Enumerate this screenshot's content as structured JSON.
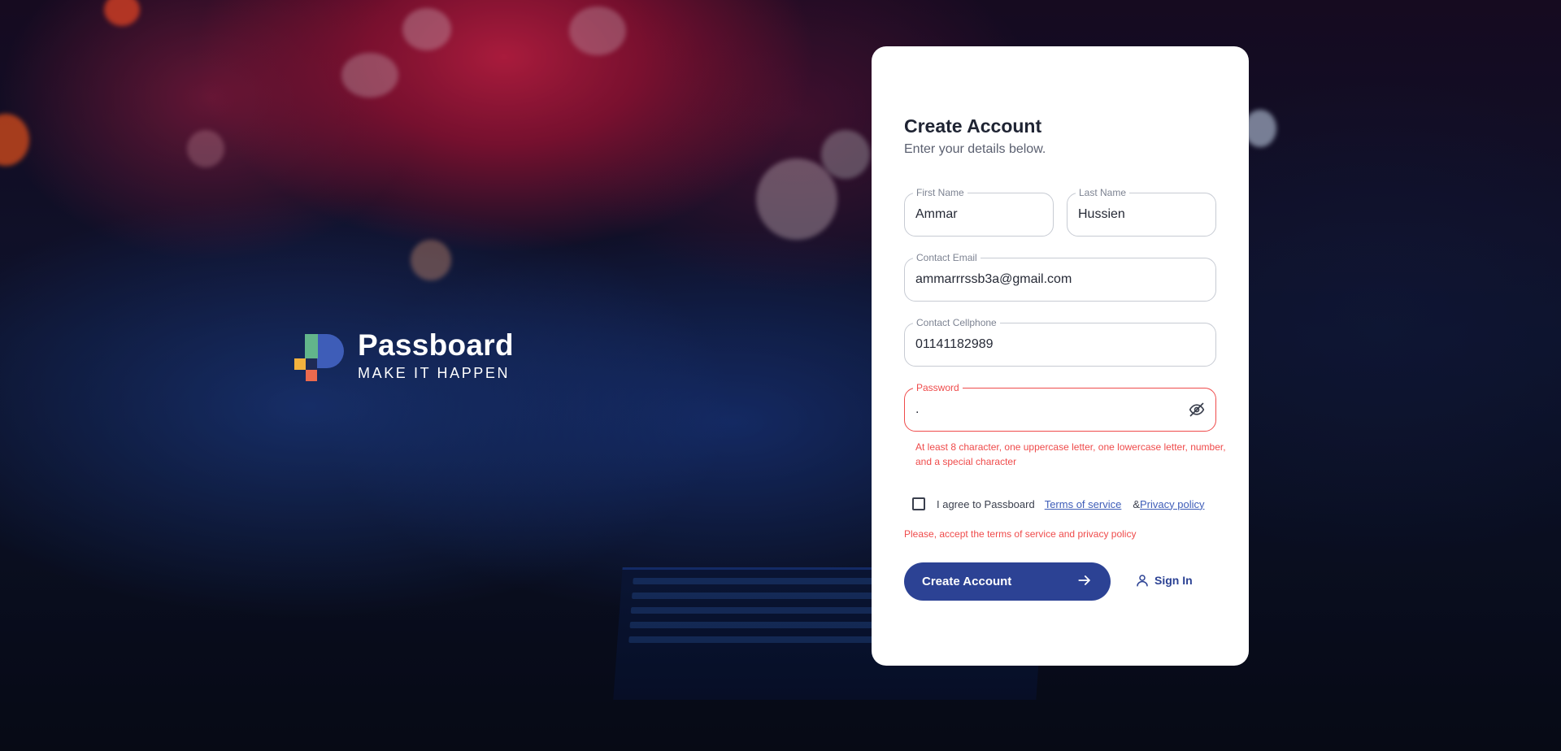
{
  "brand": {
    "name": "Passboard",
    "tagline": "MAKE IT HAPPEN"
  },
  "form": {
    "title": "Create Account",
    "subtitle": "Enter your details below.",
    "first_name": {
      "label": "First Name",
      "value": "Ammar"
    },
    "last_name": {
      "label": "Last Name",
      "value": "Hussien"
    },
    "email": {
      "label": "Contact Email",
      "value": "ammarrrssb3a@gmail.com"
    },
    "phone": {
      "label": "Contact Cellphone",
      "value": "01141182989"
    },
    "password": {
      "label": "Password",
      "value": "."
    },
    "password_error": "At least 8 character, one uppercase letter, one lowercase letter, number, and a special character",
    "agree": {
      "text": "I agree to Passboard",
      "terms_link": "Terms of service",
      "amp": "&",
      "privacy_link": "Privacy policy"
    },
    "terms_error": "Please, accept the terms of service and privacy policy",
    "submit_label": "Create Account",
    "signin_label": "Sign In"
  },
  "colors": {
    "primary": "#2c4294",
    "error": "#ef4b4b",
    "card": "#ffffff"
  },
  "icons": {
    "password_toggle": "eye-off-icon",
    "submit": "arrow-right-icon",
    "signin": "user-icon"
  }
}
